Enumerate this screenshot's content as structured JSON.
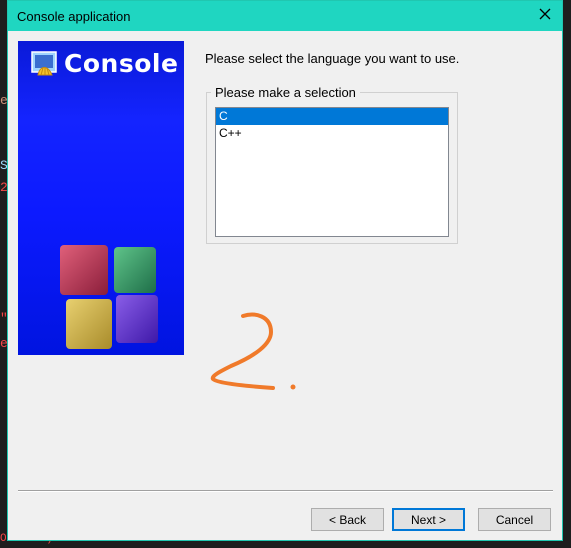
{
  "window": {
    "title": "Console application"
  },
  "background": {
    "fragments": [
      "e",
      "S",
      "2",
      "\"",
      "e",
      "OS MAC )"
    ]
  },
  "banner": {
    "title": "Console"
  },
  "prompt": "Please select the language you want to use.",
  "group": {
    "label": "Please make a selection"
  },
  "languages": [
    {
      "label": "C",
      "selected": true
    },
    {
      "label": "C++",
      "selected": false
    }
  ],
  "buttons": {
    "back": "< Back",
    "next": "Next >",
    "cancel": "Cancel"
  },
  "colors": {
    "titlebar": "#1fd6c1",
    "selection": "#0078d7",
    "banner": "#0c1aff",
    "annotation": "#f07a2a"
  },
  "icons": {
    "close": "close-icon",
    "logo": "console-logo-icon"
  }
}
